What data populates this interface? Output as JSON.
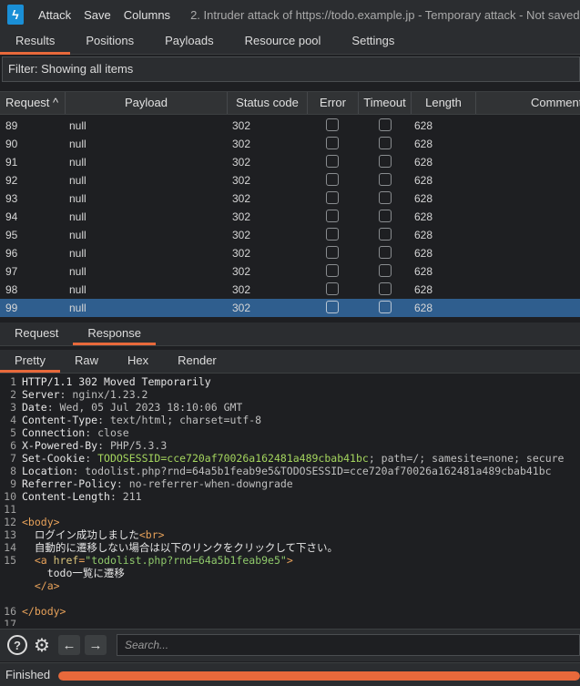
{
  "menu": {
    "attack": "Attack",
    "save": "Save",
    "columns": "Columns",
    "window_title": "2. Intruder attack of https://todo.example.jp - Temporary attack - Not saved"
  },
  "tabs": [
    "Results",
    "Positions",
    "Payloads",
    "Resource pool",
    "Settings"
  ],
  "filter_text": "Filter: Showing all items",
  "columns": {
    "request": "Request ^",
    "payload": "Payload",
    "status": "Status code",
    "error": "Error",
    "timeout": "Timeout",
    "length": "Length",
    "comment": "Comment"
  },
  "rows": [
    {
      "request": "89",
      "payload": "null",
      "status": "302",
      "length": "628"
    },
    {
      "request": "90",
      "payload": "null",
      "status": "302",
      "length": "628"
    },
    {
      "request": "91",
      "payload": "null",
      "status": "302",
      "length": "628"
    },
    {
      "request": "92",
      "payload": "null",
      "status": "302",
      "length": "628"
    },
    {
      "request": "93",
      "payload": "null",
      "status": "302",
      "length": "628"
    },
    {
      "request": "94",
      "payload": "null",
      "status": "302",
      "length": "628"
    },
    {
      "request": "95",
      "payload": "null",
      "status": "302",
      "length": "628"
    },
    {
      "request": "96",
      "payload": "null",
      "status": "302",
      "length": "628"
    },
    {
      "request": "97",
      "payload": "null",
      "status": "302",
      "length": "628"
    },
    {
      "request": "98",
      "payload": "null",
      "status": "302",
      "length": "628"
    },
    {
      "request": "99",
      "payload": "null",
      "status": "302",
      "length": "628"
    }
  ],
  "selected_row": "99",
  "rr_tabs": [
    "Request",
    "Response"
  ],
  "view_tabs": [
    "Pretty",
    "Raw",
    "Hex",
    "Render"
  ],
  "response": {
    "l1": "HTTP/1.1 302 Moved Temporarily",
    "l2k": "Server",
    "l2v": ": nginx/1.23.2",
    "l3k": "Date",
    "l3v": ": Wed, 05 Jul 2023 18:10:06 GMT",
    "l4k": "Content-Type",
    "l4v": ": text/html; charset=utf-8",
    "l5k": "Connection",
    "l5v": ": close",
    "l6k": "X-Powered-By",
    "l6v": ": PHP/5.3.3",
    "l7k": "Set-Cookie",
    "l7a": ": ",
    "l7c": "TODOSESSID=cce720af70026a162481a489cbab41bc",
    "l7v": "; path=/; samesite=none; secure",
    "l8k": "Location",
    "l8v": ": todolist.php?rnd=64a5b1feab9e5&TODOSESSID=cce720af70026a162481a489cbab41bc",
    "l9k": "Referrer-Policy",
    "l9v": ": no-referrer-when-downgrade",
    "l10k": "Content-Length",
    "l10v": ": 211",
    "l12": "<body>",
    "l13t": "  ログイン成功しました",
    "l13br": "<br>",
    "l14": "  自動的に遷移しない場合は以下のリンクをクリックして下さい。",
    "l15a": "  <a ",
    "l15b": "href",
    "l15c": "=",
    "l15d": "\"todolist.php?rnd=64a5b1feab9e5\"",
    "l15e": ">",
    "l15f": "    todo一覧に遷移",
    "l15g": "  </a>",
    "l16": "</body>"
  },
  "search_placeholder": "Search...",
  "status": "Finished",
  "progress": 1.0,
  "colors": {
    "accent": "#e8693b",
    "selection": "#2f5e8e"
  }
}
